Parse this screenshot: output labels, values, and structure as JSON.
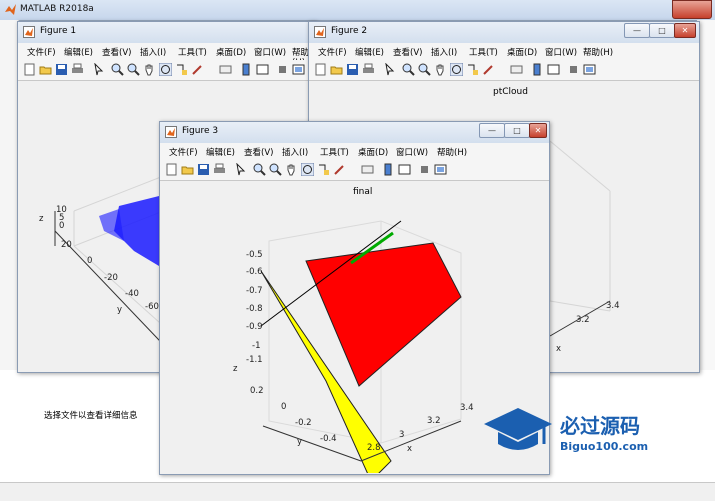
{
  "main_window": {
    "title": "MATLAB R2018a",
    "status_text": "选择文件以查看详细信息"
  },
  "menu": [
    "文件(F)",
    "编辑(E)",
    "查看(V)",
    "插入(I)",
    "工具(T)",
    "桌面(D)",
    "窗口(W)",
    "帮助(H)"
  ],
  "figures": [
    {
      "title": "Figure 1",
      "axes": {
        "zlabel": "z",
        "ylabel": "y",
        "z_ticks": [
          "10",
          "5",
          "0"
        ],
        "y_ticks": [
          "20",
          "0",
          "-20",
          "-40",
          "-60"
        ]
      }
    },
    {
      "title": "Figure 2",
      "plot_title": "ptCloud",
      "axes": {
        "xlabel": "x",
        "x_ticks": [
          "3.4",
          "3.2"
        ]
      }
    },
    {
      "title": "Figure 3",
      "plot_title": "final",
      "axes": {
        "zlabel": "z",
        "ylabel": "y",
        "xlabel": "x",
        "z_ticks": [
          "-0.5",
          "-0.6",
          "-0.7",
          "-0.8",
          "-0.9",
          "-1",
          "-1.1"
        ],
        "y_ticks": [
          "0.2",
          "0",
          "-0.2",
          "-0.4"
        ],
        "x_ticks": [
          "2.8",
          "3",
          "3.2",
          "3.4"
        ]
      },
      "colors": {
        "plane1": "#ff0000",
        "plane2": "#ffff00",
        "line1": "#00aa00",
        "line2": "#000000"
      }
    }
  ],
  "watermark": {
    "text": "必过源码",
    "sub": "Biguo100.com",
    "color": "#1b5fb0"
  }
}
